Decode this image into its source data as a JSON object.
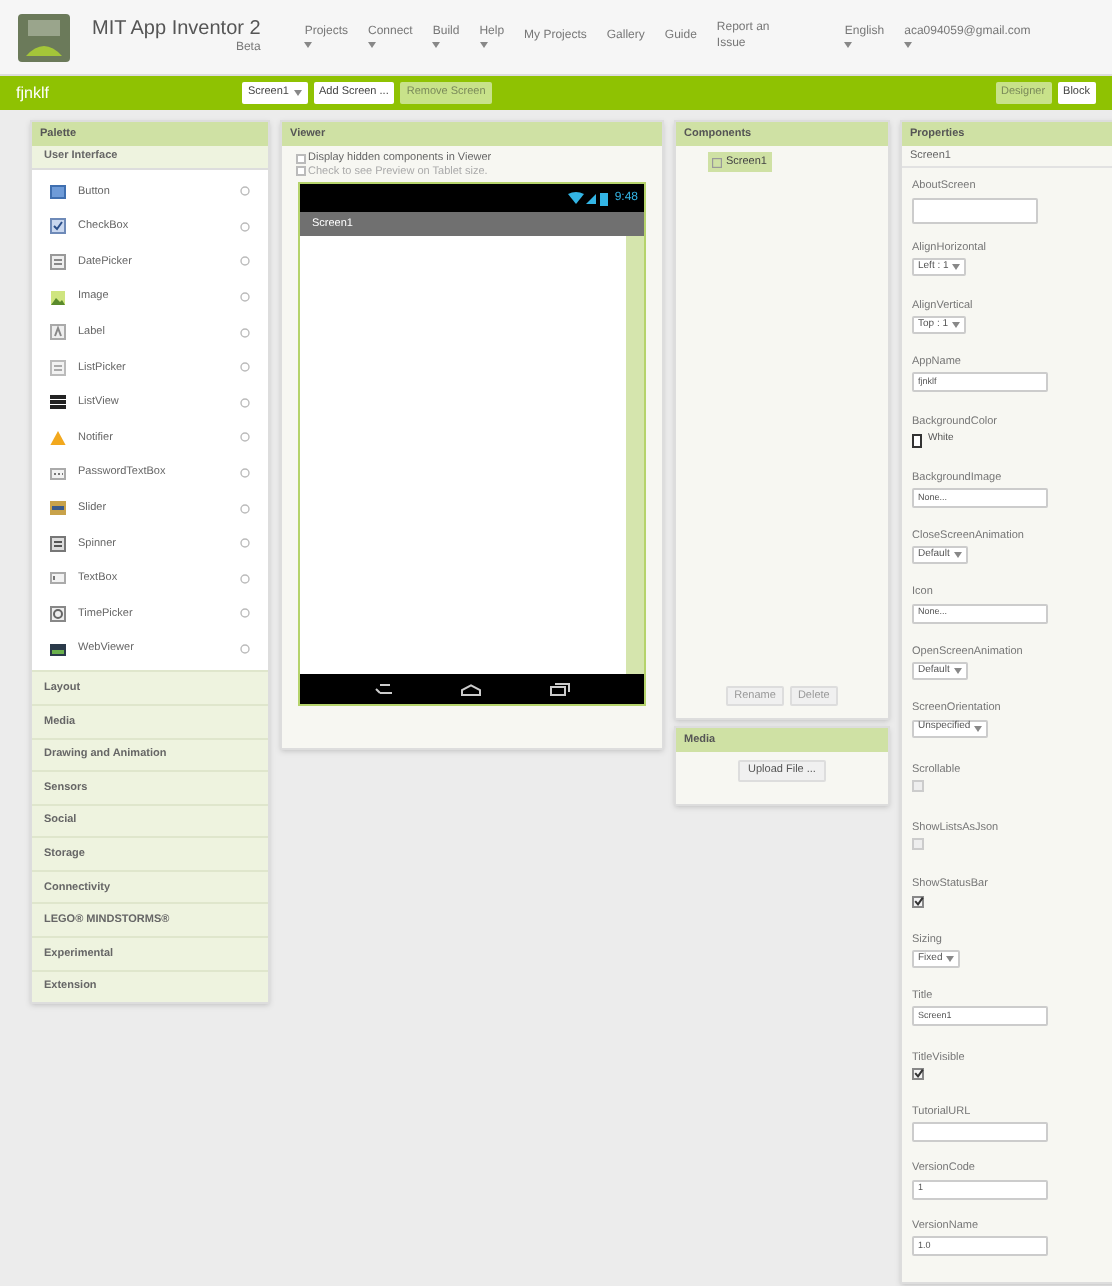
{
  "header": {
    "logo_title": "MIT App Inventor 2",
    "logo_subtitle": "Beta",
    "menu": [
      {
        "label": "Projects",
        "dropdown": true
      },
      {
        "label": "Connect",
        "dropdown": true
      },
      {
        "label": "Build",
        "dropdown": true
      },
      {
        "label": "Help",
        "dropdown": true
      },
      {
        "label": "My Projects",
        "dropdown": false
      },
      {
        "label": "Gallery",
        "dropdown": false
      },
      {
        "label": "Guide",
        "dropdown": false
      },
      {
        "label": "Report an Issue",
        "dropdown": false
      },
      {
        "label": "English",
        "dropdown": true
      },
      {
        "label": "aca094059@gmail.com",
        "dropdown": true
      }
    ]
  },
  "toolbar": {
    "project_name": "fjnklf",
    "screen_select": "Screen1",
    "buttons": [
      {
        "label": "Add Screen ...",
        "disabled": false
      },
      {
        "label": "Remove Screen",
        "disabled": true
      }
    ],
    "views": [
      {
        "label": "Designer",
        "selected": true
      },
      {
        "label": "Block",
        "selected": false
      }
    ]
  },
  "palette": {
    "title": "Palette",
    "open_category": "User Interface",
    "items": [
      {
        "label": "Button",
        "kind": "button"
      },
      {
        "label": "CheckBox",
        "kind": "checkbox"
      },
      {
        "label": "DatePicker",
        "kind": "datepicker"
      },
      {
        "label": "Image",
        "kind": "image"
      },
      {
        "label": "Label",
        "kind": "label"
      },
      {
        "label": "ListPicker",
        "kind": "listpicker"
      },
      {
        "label": "ListView",
        "kind": "listview"
      },
      {
        "label": "Notifier",
        "kind": "notifier"
      },
      {
        "label": "PasswordTextBox",
        "kind": "password"
      },
      {
        "label": "Slider",
        "kind": "slider"
      },
      {
        "label": "Spinner",
        "kind": "spinner"
      },
      {
        "label": "TextBox",
        "kind": "textbox"
      },
      {
        "label": "TimePicker",
        "kind": "timepicker"
      },
      {
        "label": "WebViewer",
        "kind": "webviewer"
      }
    ],
    "categories": [
      "Layout",
      "Media",
      "Drawing and Animation",
      "Sensors",
      "Social",
      "Storage",
      "Connectivity",
      "LEGO® MINDSTORMS®",
      "Experimental",
      "Extension"
    ]
  },
  "viewer": {
    "title": "Viewer",
    "options": [
      {
        "label": "Display hidden components in Viewer",
        "checked": false
      },
      {
        "label": "Check to see Preview on Tablet size.",
        "checked": false
      }
    ],
    "phone": {
      "time": "9:48",
      "screen_title": "Screen1"
    }
  },
  "components": {
    "title": "Components",
    "tree": [
      {
        "label": "Screen1",
        "selected": true
      }
    ],
    "buttons": [
      "Rename",
      "Delete"
    ]
  },
  "media": {
    "title": "Media",
    "button": "Upload File ..."
  },
  "properties": {
    "title": "Properties",
    "component": "Screen1",
    "items": [
      {
        "name": "AboutScreen",
        "kind": "textarea",
        "value": ""
      },
      {
        "name": "AlignHorizontal",
        "kind": "dropdown",
        "value": "Left : 1"
      },
      {
        "name": "AlignVertical",
        "kind": "dropdown",
        "value": "Top : 1"
      },
      {
        "name": "AppName",
        "kind": "text",
        "value": "fjnklf"
      },
      {
        "name": "BackgroundColor",
        "kind": "color",
        "value": "White",
        "color": "#ffffff"
      },
      {
        "name": "BackgroundImage",
        "kind": "text",
        "value": "None..."
      },
      {
        "name": "CloseScreenAnimation",
        "kind": "dropdown",
        "value": "Default"
      },
      {
        "name": "Icon",
        "kind": "text",
        "value": "None..."
      },
      {
        "name": "OpenScreenAnimation",
        "kind": "dropdown",
        "value": "Default"
      },
      {
        "name": "ScreenOrientation",
        "kind": "dropdown",
        "value": "Unspecified"
      },
      {
        "name": "Scrollable",
        "kind": "checkbox",
        "checked": false
      },
      {
        "name": "ShowListsAsJson",
        "kind": "checkbox",
        "checked": false
      },
      {
        "name": "ShowStatusBar",
        "kind": "checkbox",
        "checked": true
      },
      {
        "name": "Sizing",
        "kind": "dropdown",
        "value": "Fixed"
      },
      {
        "name": "Title",
        "kind": "text",
        "value": "Screen1"
      },
      {
        "name": "TitleVisible",
        "kind": "checkbox",
        "checked": true
      },
      {
        "name": "TutorialURL",
        "kind": "text",
        "value": ""
      },
      {
        "name": "VersionCode",
        "kind": "text",
        "value": "1"
      },
      {
        "name": "VersionName",
        "kind": "text",
        "value": "1.0"
      }
    ]
  }
}
